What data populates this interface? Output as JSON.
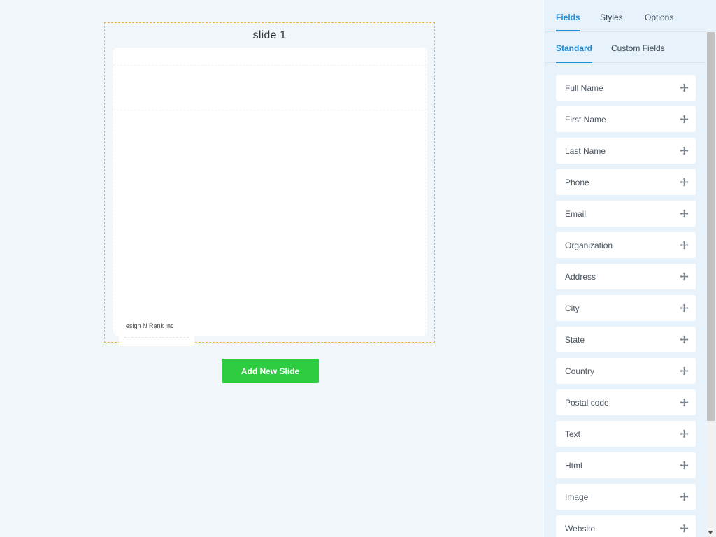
{
  "canvas": {
    "slide_title": "slide 1",
    "footer_text": "esign N Rank Inc",
    "add_slide_label": "Add New Slide"
  },
  "panel": {
    "tabs": [
      {
        "label": "Fields",
        "active": true
      },
      {
        "label": "Styles",
        "active": false
      },
      {
        "label": "Options",
        "active": false
      }
    ],
    "sub_tabs": [
      {
        "label": "Standard",
        "active": true
      },
      {
        "label": "Custom Fields",
        "active": false
      }
    ],
    "fields": [
      {
        "label": "Full Name",
        "icon": "move-icon"
      },
      {
        "label": "First Name",
        "icon": "move-icon"
      },
      {
        "label": "Last Name",
        "icon": "move-icon"
      },
      {
        "label": "Phone",
        "icon": "move-icon"
      },
      {
        "label": "Email",
        "icon": "move-icon"
      },
      {
        "label": "Organization",
        "icon": "move-icon"
      },
      {
        "label": "Address",
        "icon": "move-icon"
      },
      {
        "label": "City",
        "icon": "move-icon"
      },
      {
        "label": "State",
        "icon": "move-icon"
      },
      {
        "label": "Country",
        "icon": "move-icon"
      },
      {
        "label": "Postal code",
        "icon": "move-icon"
      },
      {
        "label": "Text",
        "icon": "move-icon"
      },
      {
        "label": "Html",
        "icon": "move-icon"
      },
      {
        "label": "Image",
        "icon": "move-icon"
      },
      {
        "label": "Website",
        "icon": "move-icon"
      }
    ]
  },
  "colors": {
    "accent": "#1f8cd6",
    "add_button": "#2ecc40",
    "slide_border": "#f0b54a",
    "canvas_bg": "#f1f6fa",
    "panel_bg": "#e8f2fb"
  }
}
